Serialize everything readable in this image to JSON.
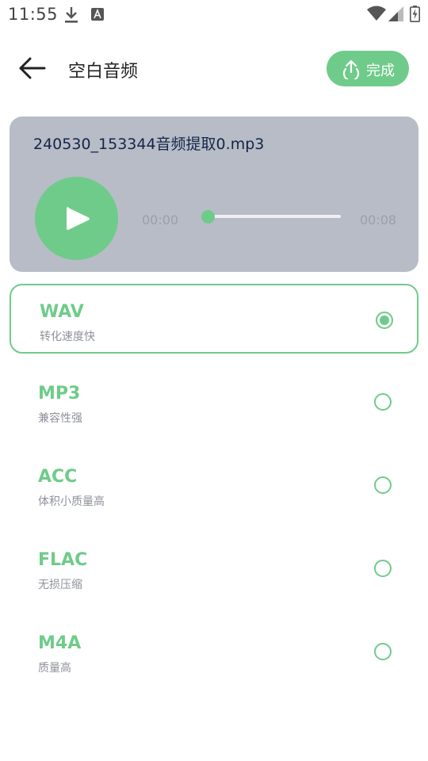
{
  "status_bar": {
    "time": "11:55",
    "icons": [
      "download-icon",
      "a-badge-icon",
      "wifi-icon",
      "signal-icon",
      "battery-charging-icon"
    ]
  },
  "header": {
    "title": "空白音频",
    "done_label": "完成",
    "back_icon": "arrow-left-icon",
    "done_icon": "upload-icon"
  },
  "player": {
    "file_name": "240530_153344音频提取0.mp3",
    "current_time": "00:00",
    "total_time": "00:08",
    "progress": 0,
    "play_icon": "play-icon"
  },
  "formats": [
    {
      "name": "WAV",
      "desc": "转化速度快",
      "selected": true
    },
    {
      "name": "MP3",
      "desc": "兼容性强",
      "selected": false
    },
    {
      "name": "ACC",
      "desc": "体积小质量高",
      "selected": false
    },
    {
      "name": "FLAC",
      "desc": "无损压缩",
      "selected": false
    },
    {
      "name": "M4A",
      "desc": "质量高",
      "selected": false
    }
  ],
  "colors": {
    "accent": "#6fcb8a",
    "card_bg": "#b8bcc6",
    "file_name_text": "#13264a"
  }
}
